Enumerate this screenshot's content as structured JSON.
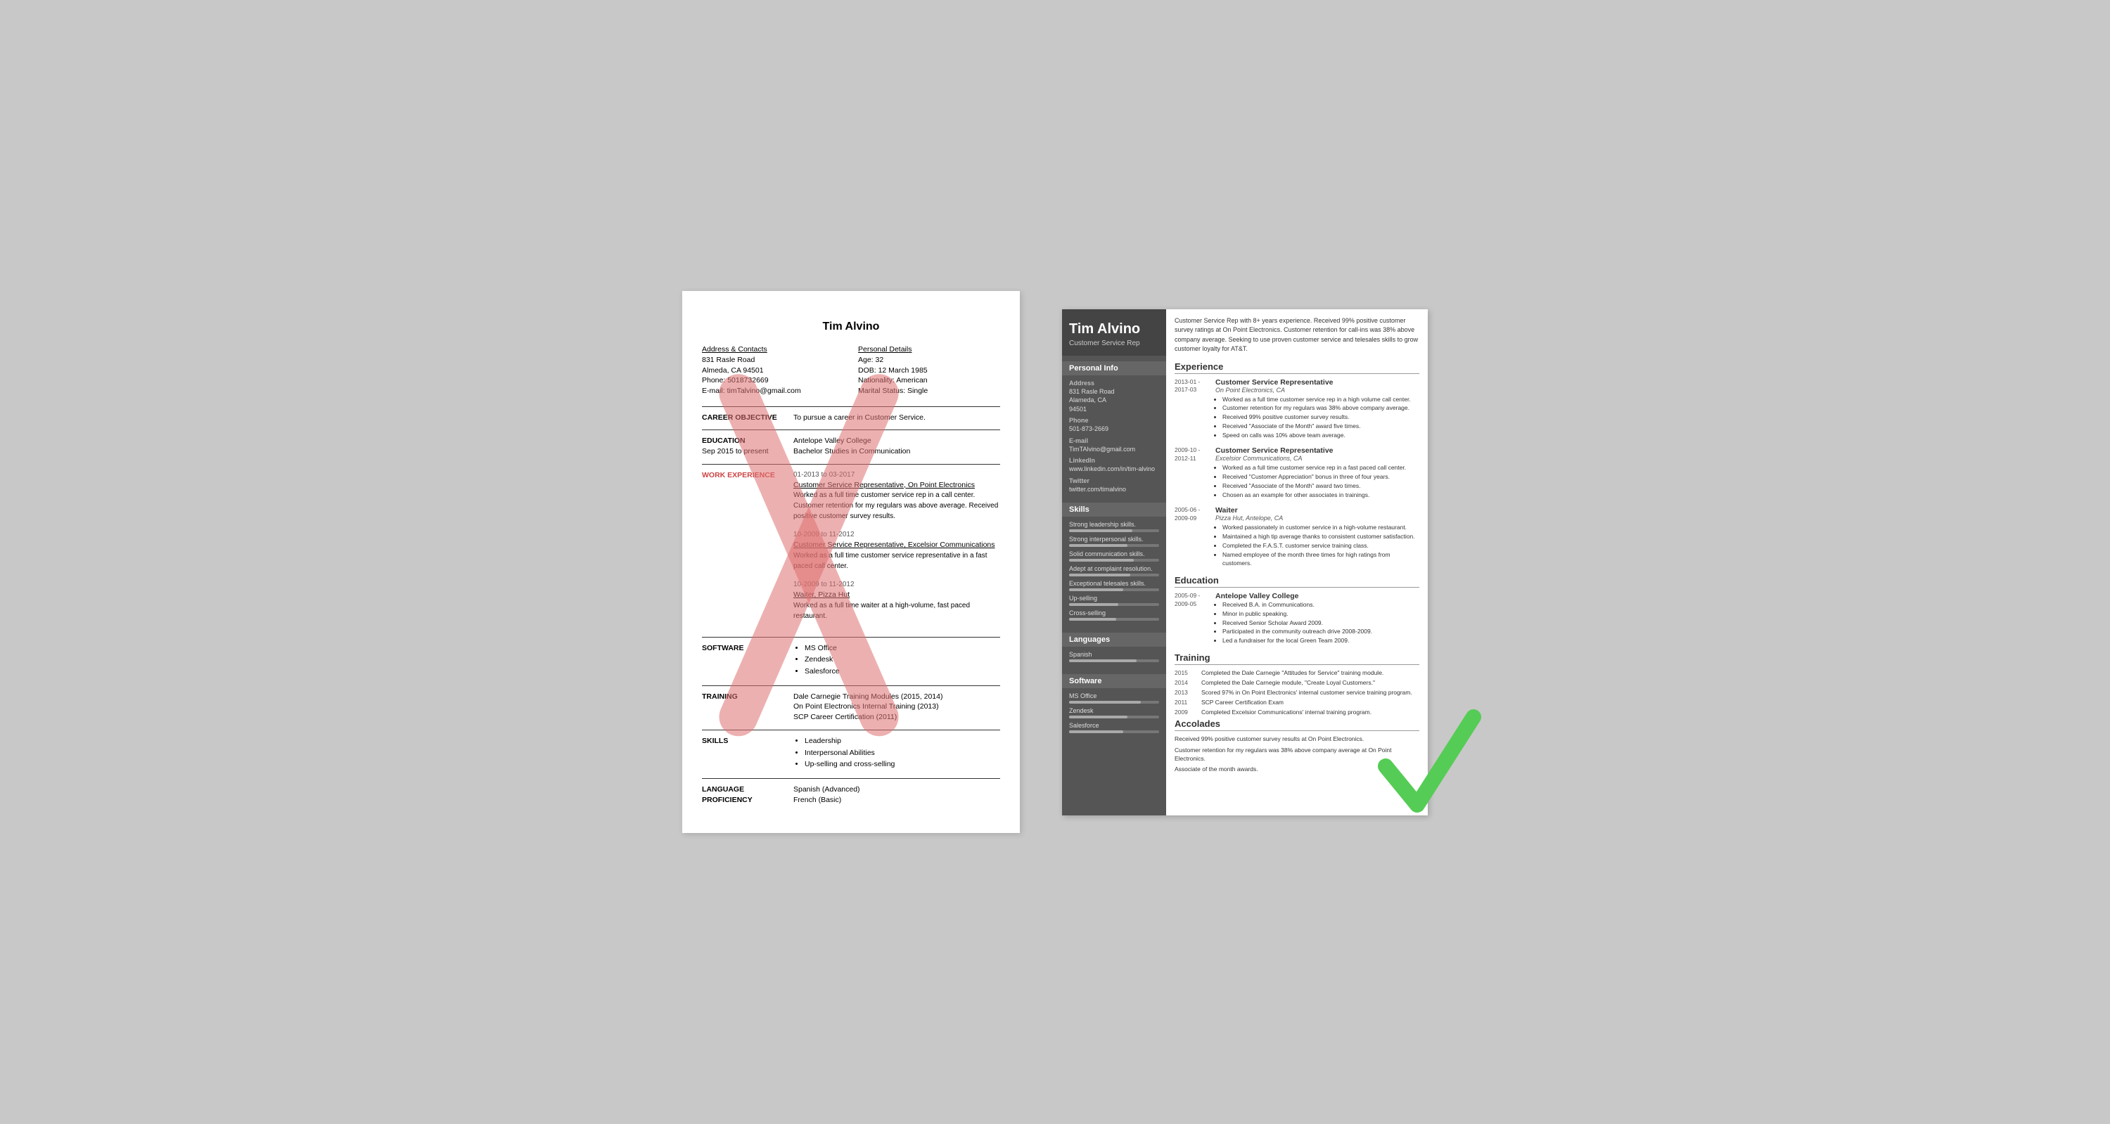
{
  "bad_resume": {
    "name": "Tim Alvino",
    "contact": {
      "address_label": "Address & Contacts",
      "address": "831 Rasle Road",
      "city": "Almeda, CA 94501",
      "phone": "Phone: 5018732669",
      "email": "E-mail: timTalvino@gmail.com",
      "personal_label": "Personal Details",
      "age": "Age:   32",
      "dob": "DOB:  12 March 1985",
      "nationality": "Nationality: American",
      "marital": "Marital Status: Single"
    },
    "career_objective": {
      "label": "CAREER OBJECTIVE",
      "value": "To pursue a career in Customer Service."
    },
    "education": {
      "label": "EDUCATION",
      "date": "Sep 2015 to present",
      "school": "Antelope Valley College",
      "degree": "Bachelor Studies in Communication"
    },
    "work_experience": {
      "label": "WORK EXPERIENCE",
      "entries": [
        {
          "date": "01-2013 to 03-2017",
          "title": "Customer Service Representative, On Point Electronics",
          "desc": "Worked as a full time customer service rep in a call center. Customer retention for my regulars was above average. Received positive customer survey results."
        },
        {
          "date": "10-2009 to 11-2012",
          "title": "Customer Service Representative, Excelsior Communications",
          "desc": "Worked as a full time customer service representative in a fast paced call center."
        },
        {
          "date": "10-2009 to 11-2012",
          "title": "Waiter, Pizza Hut",
          "desc": "Worked as a full time waiter at a high-volume, fast paced restaurant."
        }
      ]
    },
    "software": {
      "label": "SOFTWARE",
      "items": [
        "MS Office",
        "Zendesk",
        "Salesforce"
      ]
    },
    "training": {
      "label": "TRAINING",
      "items": [
        "Dale Carnegie Training Modules (2015, 2014)",
        "On Point Electronics Internal Training (2013)",
        "SCP Career Certification (2011)"
      ]
    },
    "skills": {
      "label": "SKILLS",
      "items": [
        "Leadership",
        "Interpersonal Abilities",
        "Up-selling and cross-selling"
      ]
    },
    "language": {
      "label": "LANGUAGE PROFICIENCY",
      "items": [
        "Spanish (Advanced)",
        "French (Basic)"
      ]
    }
  },
  "good_resume": {
    "sidebar": {
      "name": "Tim Alvino",
      "title": "Customer Service Rep",
      "personal_info_title": "Personal Info",
      "address_label": "Address",
      "address": "831 Rasle Road\nAlameda, CA\n94501",
      "phone_label": "Phone",
      "phone": "501-873-2669",
      "email_label": "E-mail",
      "email": "TimTAlvino@gmail.com",
      "linkedin_label": "LinkedIn",
      "linkedin": "www.linkedin.com/in/tim-alvino",
      "twitter_label": "Twitter",
      "twitter": "twitter.com/timalvino",
      "skills_title": "Skills",
      "skills": [
        {
          "name": "Strong leadership skills.",
          "pct": 70
        },
        {
          "name": "Strong interpersonal skills.",
          "pct": 65
        },
        {
          "name": "Solid communication skills.",
          "pct": 72
        },
        {
          "name": "Adept at complaint resolution.",
          "pct": 68
        },
        {
          "name": "Exceptional telesales skills.",
          "pct": 60
        },
        {
          "name": "Up-selling",
          "pct": 55
        },
        {
          "name": "Cross-selling",
          "pct": 52
        }
      ],
      "languages_title": "Languages",
      "languages": [
        {
          "name": "Spanish",
          "pct": 75
        }
      ],
      "software_title": "Software",
      "software": [
        {
          "name": "MS Office",
          "pct": 80
        },
        {
          "name": "Zendesk",
          "pct": 65
        },
        {
          "name": "Salesforce",
          "pct": 60
        }
      ]
    },
    "main": {
      "summary": "Customer Service Rep with 8+ years experience. Received 99% positive customer survey ratings at On Point Electronics. Customer retention for call-ins was 38% above company average. Seeking to use proven customer service and telesales skills to grow customer loyalty for AT&T.",
      "experience_title": "Experience",
      "experience": [
        {
          "date": "2013-01 -\n2017-03",
          "title": "Customer Service Representative",
          "company": "On Point Electronics, CA",
          "bullets": [
            "Worked as a full time customer service rep in a high volume call center.",
            "Customer retention for my regulars was 38% above company average.",
            "Received 99% positive customer survey results.",
            "Received \"Associate of the Month\" award five times.",
            "Speed on calls was 10% above team average."
          ]
        },
        {
          "date": "2009-10 -\n2012-11",
          "title": "Customer Service Representative",
          "company": "Excelsior Communications, CA",
          "bullets": [
            "Worked as a full time customer service rep in a fast paced call center.",
            "Received \"Customer Appreciation\" bonus in three of four years.",
            "Received \"Associate of the Month\" award two times.",
            "Chosen as an example for other associates in trainings."
          ]
        },
        {
          "date": "2005-06 -\n2009-09",
          "title": "Waiter",
          "company": "Pizza Hut, Antelope, CA",
          "bullets": [
            "Worked passionately in customer service in a high-volume restaurant.",
            "Maintained a high tip average thanks to consistent customer satisfaction.",
            "Completed the F.A.S.T. customer service training class.",
            "Named employee of the month three times for high ratings from customers."
          ]
        }
      ],
      "education_title": "Education",
      "education": [
        {
          "date": "2005-09 -\n2009-05",
          "school": "Antelope Valley College",
          "bullets": [
            "Received B.A. in Communications.",
            "Minor in public speaking.",
            "Received Senior Scholar Award 2009.",
            "Participated in the community outreach drive 2008-2009.",
            "Led a fundraiser for the local Green Team 2009."
          ]
        }
      ],
      "training_title": "Training",
      "training": [
        {
          "year": "2015",
          "desc": "Completed the Dale Carnegie \"Attitudes for Service\" training module."
        },
        {
          "year": "2014",
          "desc": "Completed the Dale Carnegie module, \"Create Loyal Customers.\""
        },
        {
          "year": "2013",
          "desc": "Scored 97% in On Point Electronics' internal customer service training program."
        },
        {
          "year": "2011",
          "desc": "SCP Career Certification Exam"
        },
        {
          "year": "2009",
          "desc": "Completed Excelsior Communications' internal training program."
        }
      ],
      "accolades_title": "Accolades",
      "accolades": [
        "Received 99% positive customer survey results at On Point Electronics.",
        "Customer retention for my regulars was 38% above company average at On Point Electronics.",
        "Associate of the month awards."
      ]
    }
  }
}
